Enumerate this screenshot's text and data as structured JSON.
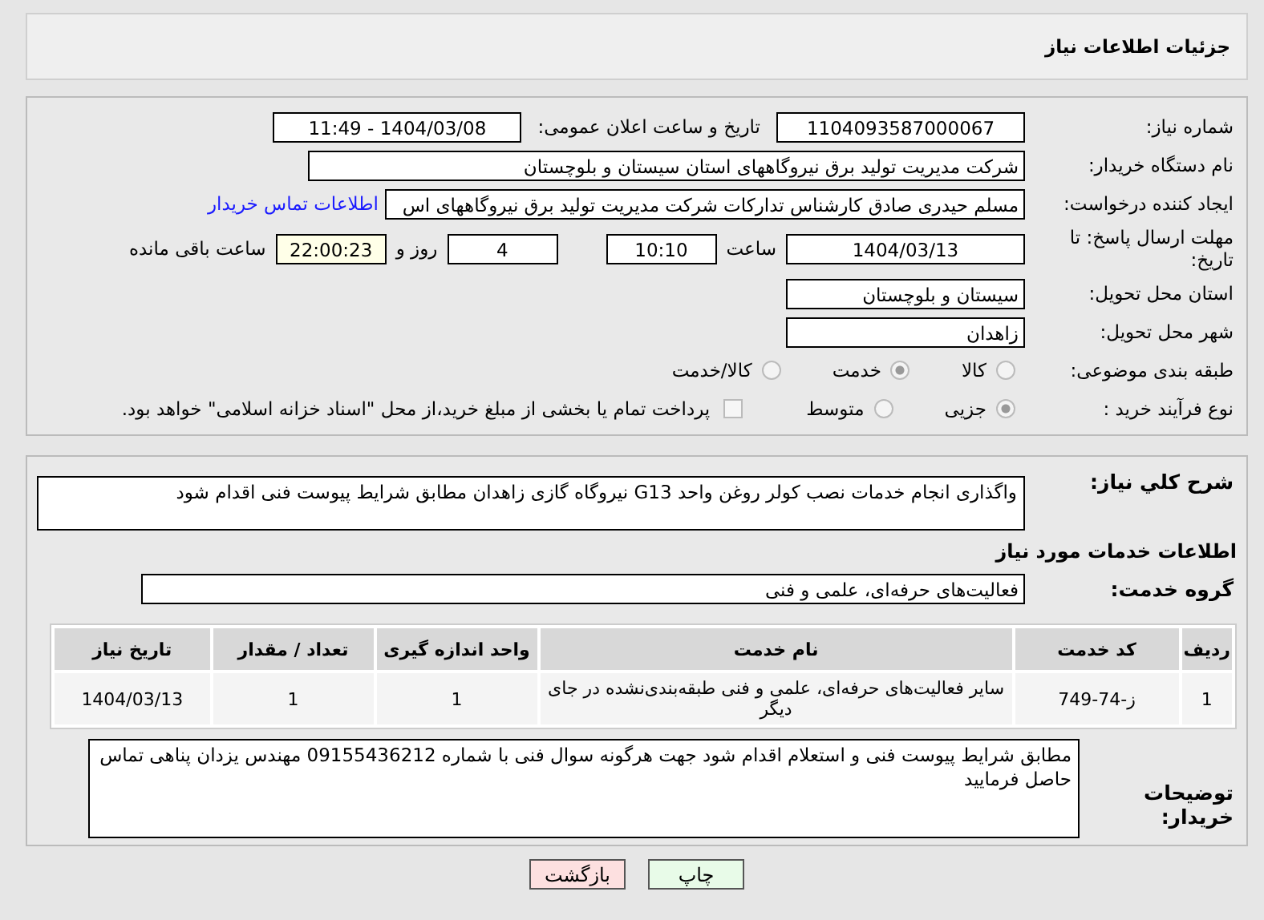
{
  "header": {
    "title": "جزئیات اطلاعات نیاز"
  },
  "need_number": {
    "label": "شماره نیاز:",
    "value": "1104093587000067"
  },
  "announce": {
    "label": "تاریخ و ساعت اعلان عمومی:",
    "value": "1404/03/08 - 11:49"
  },
  "buyer": {
    "label": "نام دستگاه خریدار:",
    "value": "شرکت مدیریت تولید برق نیروگاههای استان سیستان و بلوچستان"
  },
  "creator": {
    "label": "ایجاد کننده درخواست:",
    "value": "مسلم حیدری صادق کارشناس تدارکات شرکت مدیریت تولید برق نیروگاههای اس",
    "link": "اطلاعات تماس خریدار"
  },
  "deadline": {
    "label": "مهلت ارسال پاسخ: تا تاریخ:",
    "date": "1404/03/13",
    "time_label": "ساعت",
    "time": "10:10",
    "days": "4",
    "days_label": "روز و",
    "remaining": "22:00:23",
    "remaining_label": "ساعت باقی مانده"
  },
  "province": {
    "label": "استان محل تحویل:",
    "value": "سیستان و بلوچستان"
  },
  "city": {
    "label": "شهر محل تحویل:",
    "value": "زاهدان"
  },
  "category": {
    "label": "طبقه بندی موضوعی:",
    "options": [
      {
        "label": "کالا",
        "selected": false
      },
      {
        "label": "خدمت",
        "selected": true
      },
      {
        "label": "کالا/خدمت",
        "selected": false
      }
    ]
  },
  "process": {
    "label": "نوع فرآیند خرید :",
    "options": [
      {
        "label": "جزیی",
        "selected": true
      },
      {
        "label": "متوسط",
        "selected": false
      }
    ],
    "payment": {
      "checked": false,
      "label": "پرداخت تمام یا بخشی از مبلغ خرید،از محل \"اسناد خزانه اسلامی\" خواهد بود."
    }
  },
  "description": {
    "label": "شرح کلي نیاز:",
    "value": "واگذاری انجام خدمات نصب کولر روغن واحد G13 نیروگاه گازی زاهدان  مطابق شرایط پیوست فنی اقدام شود"
  },
  "services_heading": "اطلاعات خدمات مورد نیاز",
  "service_group": {
    "label": "گروه خدمت:",
    "value": "فعالیت‌های حرفه‌ای، علمی و فنی"
  },
  "table": {
    "columns": [
      "ردیف",
      "کد خدمت",
      "نام خدمت",
      "واحد اندازه گیری",
      "تعداد / مقدار",
      "تاریخ نیاز"
    ],
    "rows": [
      [
        "1",
        "ز-74-749",
        "سایر فعالیت‌های حرفه‌ای، علمی و فنی طبقه‌بندی‌نشده در جای دیگر",
        "1",
        "1",
        "1404/03/13"
      ]
    ]
  },
  "notes": {
    "label": "توضیحات خریدار:",
    "value": "مطابق شرایط پیوست فنی و استعلام اقدام شود جهت هرگونه سوال فنی با شماره  09155436212 مهندس یزدان پناهی تماس حاصل فرمایید"
  },
  "buttons": [
    {
      "label": "چاپ",
      "kind": "print"
    },
    {
      "label": "بازگشت",
      "kind": "back"
    }
  ]
}
